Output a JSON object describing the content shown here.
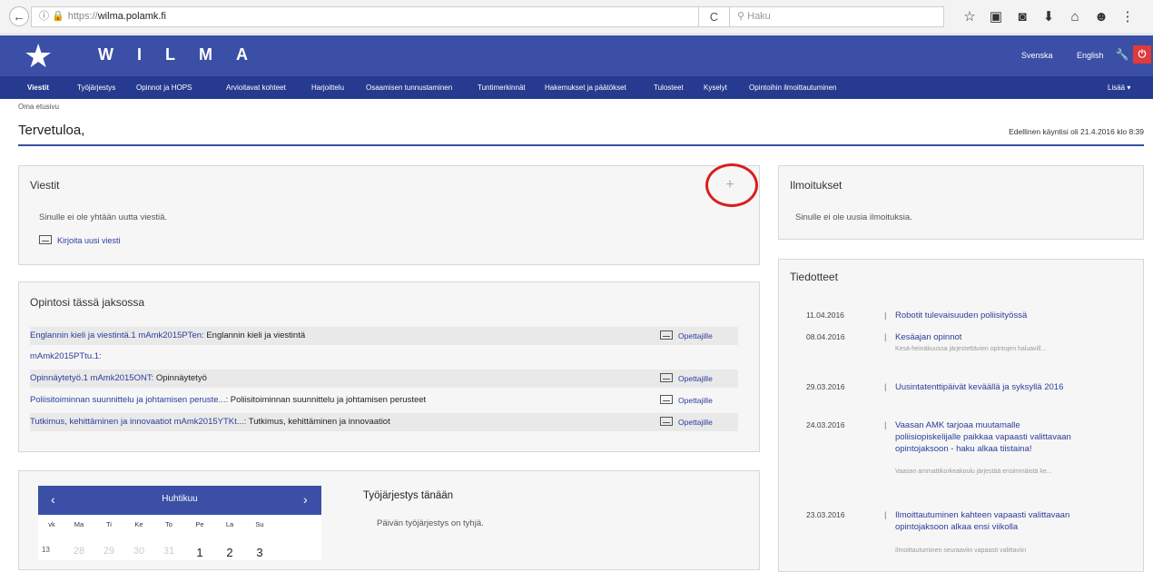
{
  "browser": {
    "url_prefix": "https://",
    "url_host": "wilma.polamk.fi",
    "search_placeholder": "Haku",
    "reload": "C"
  },
  "header": {
    "logo_text": "WILMA",
    "lang_sv": "Svenska",
    "lang_en": "English"
  },
  "nav": {
    "items": [
      "Viestit",
      "Työjärjestys",
      "Opinnot ja HOPS",
      "Arvioitavat kohteet",
      "Harjoittelu",
      "Osaamisen tunnustaminen",
      "Tuntimerkinnät",
      "Hakemukset ja päätökset",
      "Tulosteet",
      "Kyselyt",
      "Opintoihin ilmoittautuminen"
    ],
    "more": "Lisää ▾"
  },
  "breadcrumb": "Oma etusivu",
  "page_title": "Tervetuloa,",
  "last_visit": "Edellinen käyntisi oli 21.4.2016 klo 8:39",
  "messages": {
    "title": "Viestit",
    "empty": "Sinulle ei ole yhtään uutta viestiä.",
    "new_message": "Kirjoita uusi viesti"
  },
  "notifications": {
    "title": "Ilmoitukset",
    "empty": "Sinulle ei ole uusia ilmoituksia."
  },
  "courses": {
    "title": "Opintosi tässä jaksossa",
    "rows": [
      {
        "link": "Englannin kieli ja viestintä.1 mAmk2015PTen:",
        "desc": " Englannin kieli ja viestintä",
        "teacher": "Opettajille"
      },
      {
        "link": "mAmk2015PTtu.1:",
        "desc": "",
        "teacher": ""
      },
      {
        "link": "Opinnäytetyö.1 mAmk2015ONT:",
        "desc": " Opinnäytetyö",
        "teacher": "Opettajille"
      },
      {
        "link": "Poliisitoiminnan suunnittelu ja johtamisen peruste...:",
        "desc": " Poliisitoiminnan suunnittelu ja johtamisen perusteet",
        "teacher": "Opettajille"
      },
      {
        "link": "Tutkimus, kehittäminen ja innovaatiot mAmk2015YTKt...:",
        "desc": " Tutkimus, kehittäminen ja innovaatiot",
        "teacher": "Opettajille"
      }
    ]
  },
  "calendar": {
    "month": "Huhtikuu",
    "prev": "‹",
    "next": "›",
    "days": [
      "vk",
      "Ma",
      "Ti",
      "Ke",
      "To",
      "Pe",
      "La",
      "Su"
    ],
    "week": "13",
    "dates": [
      "28",
      "29",
      "30",
      "31",
      "1",
      "2",
      "3"
    ]
  },
  "schedule": {
    "title": "Työjärjestys tänään",
    "empty": "Päivän työjärjestys on tyhjä."
  },
  "news": {
    "title": "Tiedotteet",
    "items": [
      {
        "date": "11.04.2016",
        "title": "Robotit tulevaisuuden poliisityössä",
        "snippet": ""
      },
      {
        "date": "08.04.2016",
        "title": "Kesäajan opinnot",
        "snippet": "Kesä-heinäkuussa järjestettävien opintojen haluavill..."
      },
      {
        "date": "29.03.2016",
        "title": "Uusintatenttipäivät keväällä ja syksyllä 2016",
        "snippet": ""
      },
      {
        "date": "24.03.2016",
        "title": "Vaasan AMK tarjoaa muutamalle poliisiopiskelijalle paikkaa vapaasti valittavaan opintojaksoon - haku alkaa tiistaina!",
        "snippet": "Vaasan ammattikorkeakoulu järjestää ensimmäistä ke..."
      },
      {
        "date": "23.03.2016",
        "title": "Ilmoittautuminen kahteen vapaasti valittavaan opintojaksoon alkaa ensi viikolla",
        "snippet": "Ilmoittautuminen seuraaviin vapaasti valittaviin"
      }
    ]
  }
}
